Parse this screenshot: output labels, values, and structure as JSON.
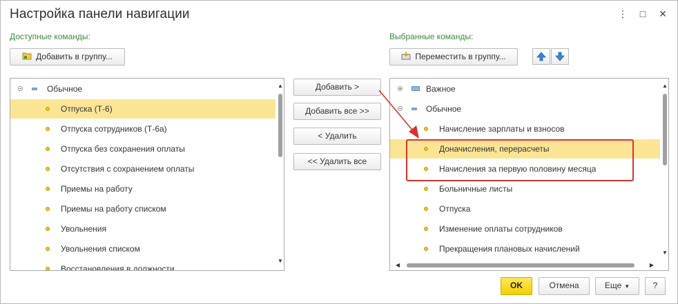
{
  "window": {
    "title": "Настройка панели навигации",
    "menu_icon": "⋮",
    "maximize_icon": "□",
    "close_icon": "✕"
  },
  "available": {
    "label": "Доступные команды:",
    "add_to_group_button": "Добавить в группу...",
    "items": [
      {
        "label": "Обычное",
        "type": "group"
      },
      {
        "label": "Отпуска (Т-6)",
        "type": "item",
        "selected": true
      },
      {
        "label": "Отпуска сотрудников (Т-6а)",
        "type": "item"
      },
      {
        "label": "Отпуска без сохранения оплаты",
        "type": "item"
      },
      {
        "label": "Отсутствия с сохранением оплаты",
        "type": "item"
      },
      {
        "label": "Приемы на работу",
        "type": "item"
      },
      {
        "label": "Приемы на работу списком",
        "type": "item"
      },
      {
        "label": "Увольнения",
        "type": "item"
      },
      {
        "label": "Увольнения списком",
        "type": "item"
      },
      {
        "label": "Восстановления в должности",
        "type": "item"
      }
    ]
  },
  "transfer": {
    "add": "Добавить >",
    "add_all": "Добавить все >>",
    "remove": "< Удалить",
    "remove_all": "<< Удалить все"
  },
  "selected": {
    "label": "Выбранные команды:",
    "move_to_group_button": "Переместить в группу...",
    "move_up_icon": "arrow-up-icon",
    "move_down_icon": "arrow-down-icon",
    "items": [
      {
        "label": "Важное",
        "type": "group-collapsed"
      },
      {
        "label": "Обычное",
        "type": "group"
      },
      {
        "label": "Начисление зарплаты и взносов",
        "type": "item"
      },
      {
        "label": "Доначисления, перерасчеты",
        "type": "item",
        "selected": true
      },
      {
        "label": "Начисления за первую половину месяца",
        "type": "item"
      },
      {
        "label": "Больничные листы",
        "type": "item"
      },
      {
        "label": "Отпуска",
        "type": "item"
      },
      {
        "label": "Изменение оплаты сотрудников",
        "type": "item"
      },
      {
        "label": "Прекращения плановых начислений",
        "type": "item"
      }
    ]
  },
  "footer": {
    "ok": "OK",
    "cancel": "Отмена",
    "more": "Еще",
    "help": "?"
  },
  "colors": {
    "selection": "#fbe595",
    "section_label": "#3a8a3a",
    "annotation": "#d9322e",
    "ok_button": "#f4cf00"
  }
}
